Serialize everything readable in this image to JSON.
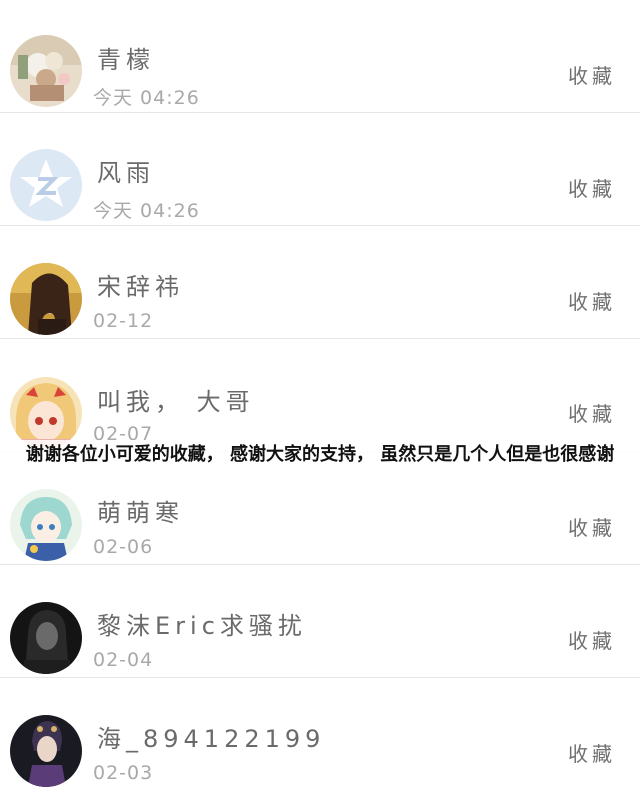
{
  "contacts": [
    {
      "name": "青檬",
      "time": "今天 04:26",
      "action": "收藏",
      "avatar": "flower-avatar"
    },
    {
      "name": "风雨",
      "time": "今天 04:26",
      "action": "收藏",
      "avatar": "qzone-default-avatar"
    },
    {
      "name": "宋辞祎",
      "time": "02-12",
      "action": "收藏",
      "avatar": "girl-photo-avatar"
    },
    {
      "name": "叫我， 大哥",
      "time": "02-07",
      "action": "收藏",
      "avatar": "anime-girl-avatar"
    },
    {
      "name": "萌萌寒",
      "time": "02-06",
      "action": "收藏",
      "avatar": "anime-character-avatar"
    },
    {
      "name": "黎沫Eric求骚扰",
      "time": "02-04",
      "action": "收藏",
      "avatar": "dark-portrait-avatar"
    },
    {
      "name": "海_894122199",
      "time": "02-03",
      "action": "收藏",
      "avatar": "costume-portrait-avatar"
    }
  ],
  "overlay_caption": "谢谢各位小可爱的收藏，  感谢大家的支持，  虽然只是几个人但是也很感谢"
}
